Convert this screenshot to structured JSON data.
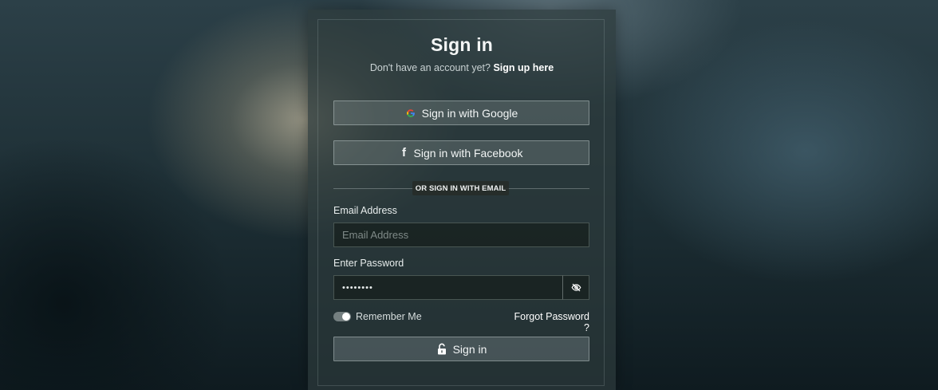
{
  "form": {
    "title": "Sign in",
    "subtitle_prefix": "Don't have an account yet?",
    "signup_link": "Sign up here",
    "google_button": "Sign in with Google",
    "facebook_button": "Sign in with Facebook",
    "divider_text": "OR SIGN IN WITH EMAIL",
    "email_label": "Email Address",
    "email_placeholder": "Email Address",
    "password_label": "Enter Password",
    "password_value": "••••••••",
    "remember_label": "Remember Me",
    "remember_checked": true,
    "forgot_link": "Forgot Password ?",
    "submit_button": "Sign in"
  },
  "icons": {
    "google": "google-icon",
    "facebook": "facebook-icon",
    "password_toggle": "eye-slash-icon",
    "submit": "lock-open-icon"
  }
}
